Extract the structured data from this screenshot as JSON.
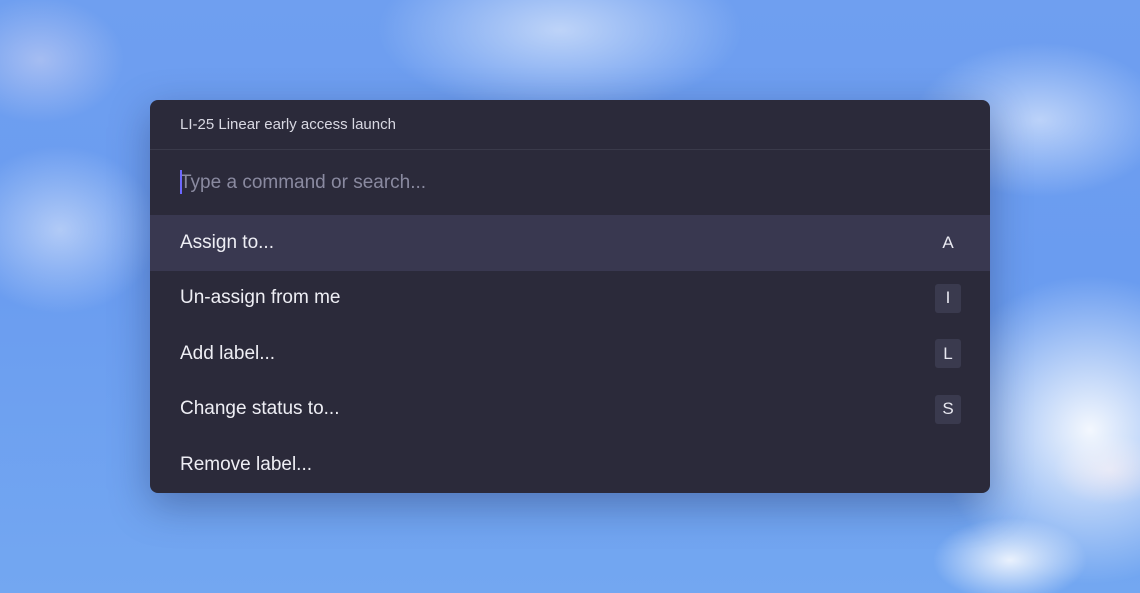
{
  "palette": {
    "context_label": "LI-25 Linear early access launch",
    "search": {
      "value": "",
      "placeholder": "Type a command or search..."
    },
    "items": [
      {
        "label": "Assign to...",
        "shortcut": "A",
        "active": true
      },
      {
        "label": "Un-assign from me",
        "shortcut": "I",
        "active": false
      },
      {
        "label": "Add label...",
        "shortcut": "L",
        "active": false
      },
      {
        "label": "Change status to...",
        "shortcut": "S",
        "active": false
      },
      {
        "label": "Remove label...",
        "shortcut": "",
        "active": false
      }
    ]
  },
  "colors": {
    "panel_bg": "#2b2a3a",
    "active_row_bg": "#393850",
    "caret": "#6d68ff",
    "sky": "#6f9ff0"
  }
}
